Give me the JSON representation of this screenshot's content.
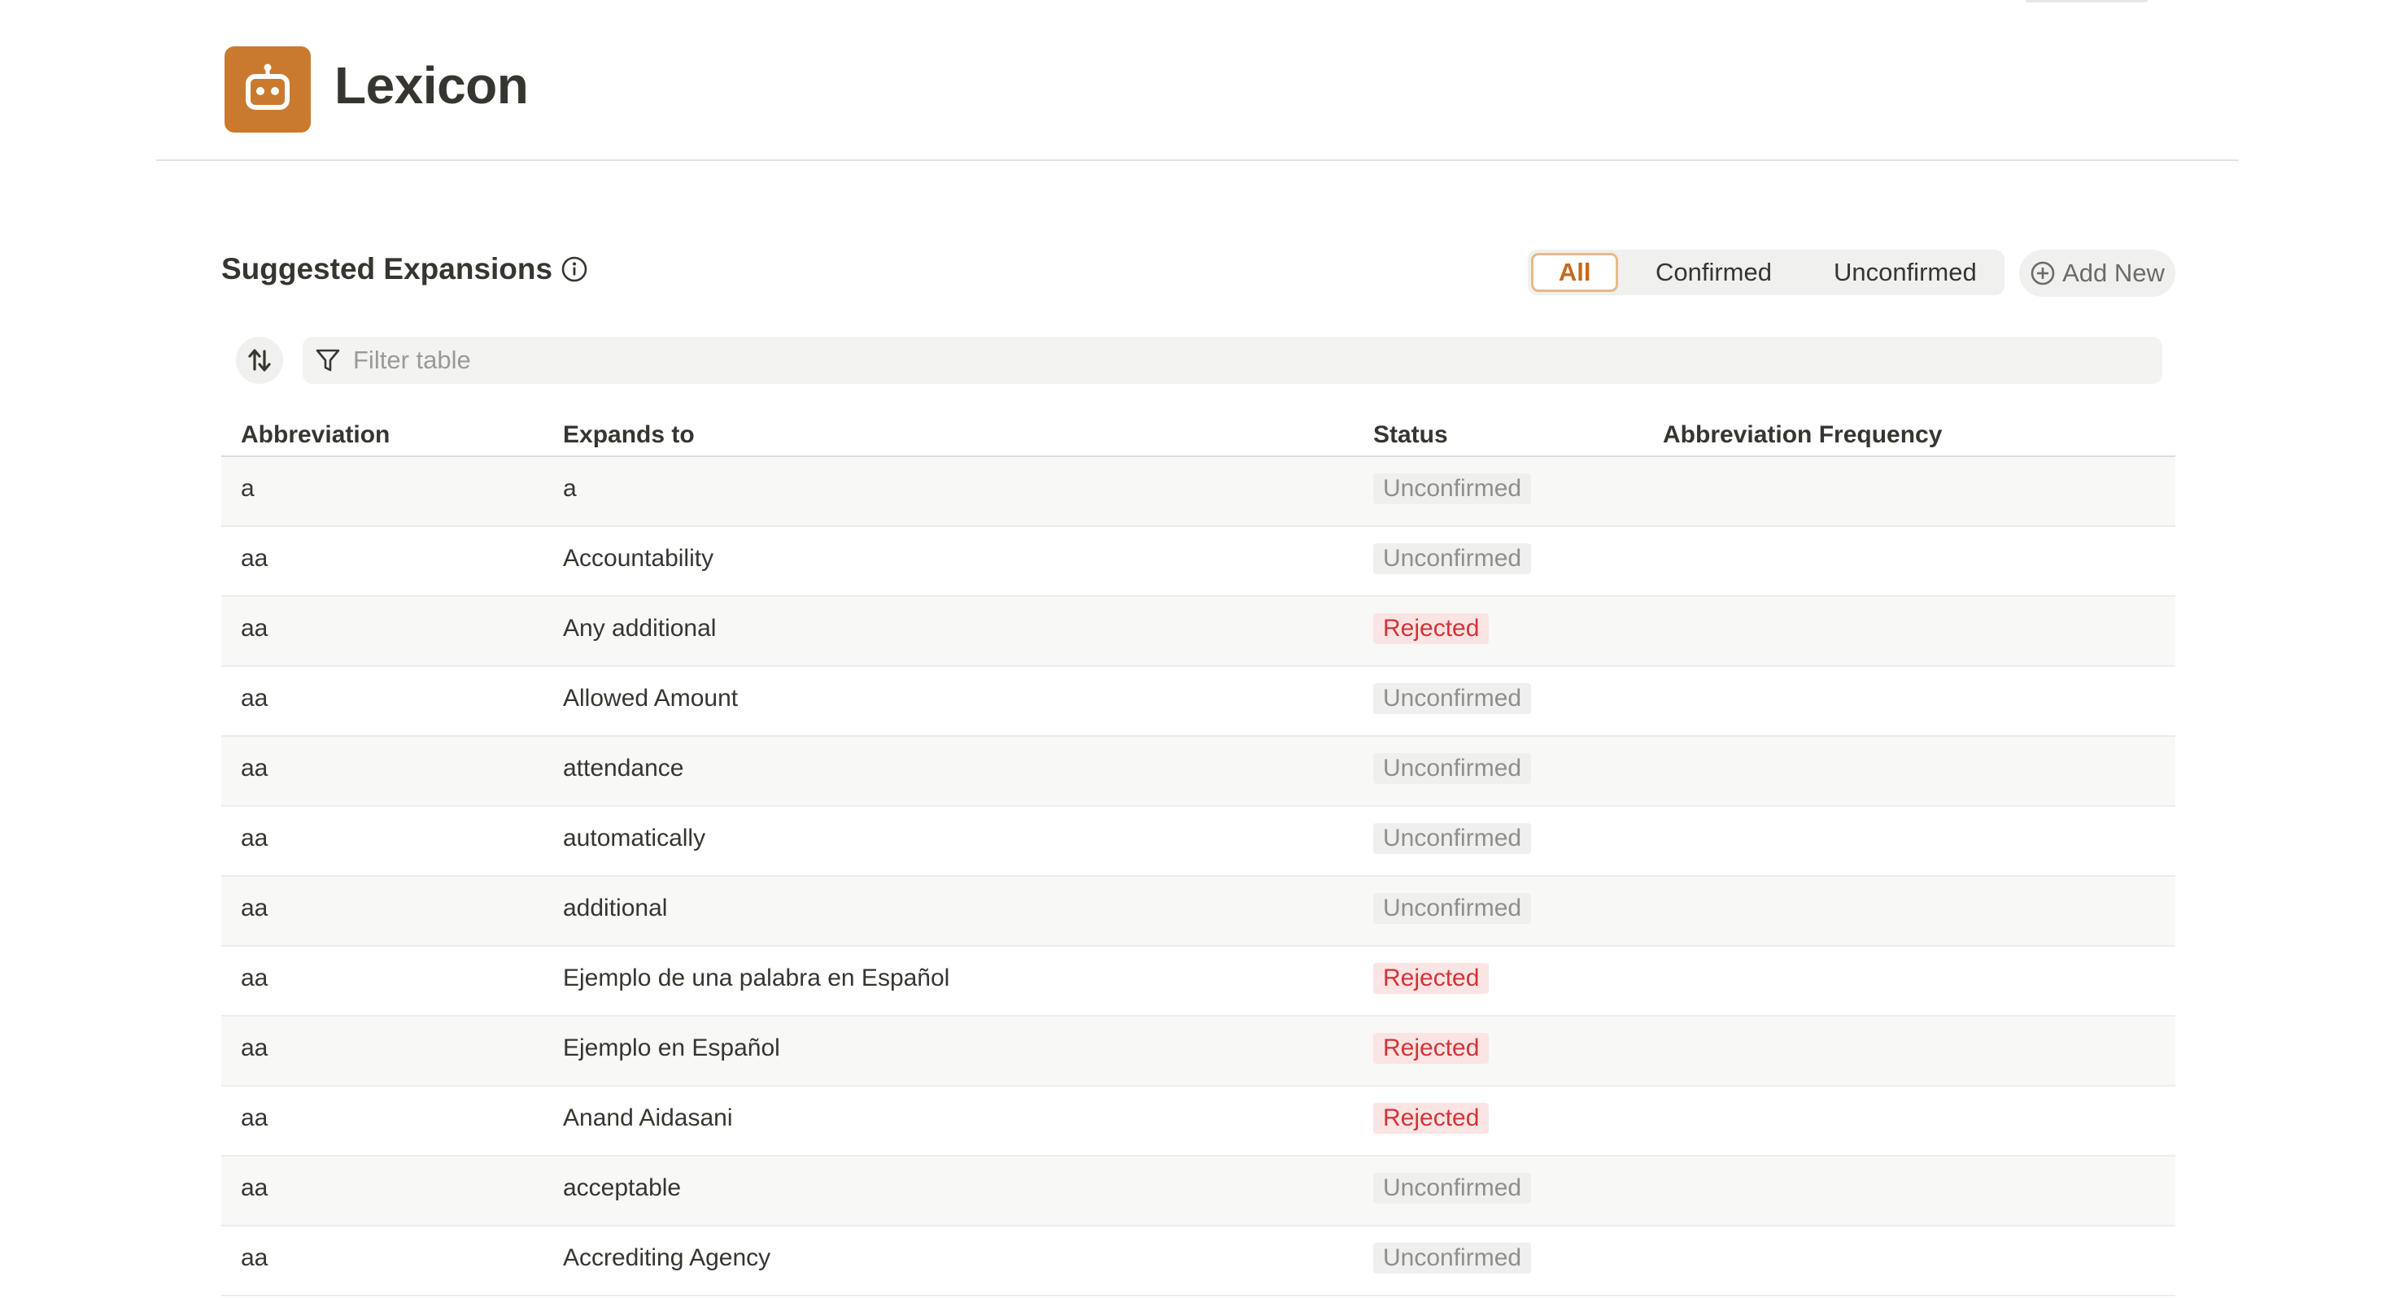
{
  "app": {
    "title": "Lexicon",
    "icon": "robot-icon",
    "accent": "#c97a2f"
  },
  "section": {
    "title": "Suggested Expansions",
    "info_icon": "info-icon"
  },
  "filters": {
    "tabs": [
      {
        "label": "All",
        "active": true
      },
      {
        "label": "Confirmed",
        "active": false
      },
      {
        "label": "Unconfirmed",
        "active": false
      }
    ],
    "add_new_label": "Add New"
  },
  "search": {
    "placeholder": "Filter table",
    "value": ""
  },
  "table": {
    "columns": [
      "Abbreviation",
      "Expands to",
      "Status",
      "Abbreviation Frequency"
    ],
    "rows": [
      {
        "abbr": "a",
        "expansion": "a",
        "status": "Unconfirmed",
        "frequency": ""
      },
      {
        "abbr": "aa",
        "expansion": "Accountability",
        "status": "Unconfirmed",
        "frequency": ""
      },
      {
        "abbr": "aa",
        "expansion": "Any additional",
        "status": "Rejected",
        "frequency": ""
      },
      {
        "abbr": "aa",
        "expansion": "Allowed Amount",
        "status": "Unconfirmed",
        "frequency": ""
      },
      {
        "abbr": "aa",
        "expansion": "attendance",
        "status": "Unconfirmed",
        "frequency": ""
      },
      {
        "abbr": "aa",
        "expansion": "automatically",
        "status": "Unconfirmed",
        "frequency": ""
      },
      {
        "abbr": "aa",
        "expansion": "additional",
        "status": "Unconfirmed",
        "frequency": ""
      },
      {
        "abbr": "aa",
        "expansion": "Ejemplo de una palabra en Español",
        "status": "Rejected",
        "frequency": ""
      },
      {
        "abbr": "aa",
        "expansion": "Ejemplo en Español",
        "status": "Rejected",
        "frequency": ""
      },
      {
        "abbr": "aa",
        "expansion": "Anand Aidasani",
        "status": "Rejected",
        "frequency": ""
      },
      {
        "abbr": "aa",
        "expansion": "acceptable",
        "status": "Unconfirmed",
        "frequency": ""
      },
      {
        "abbr": "aa",
        "expansion": "Accrediting Agency",
        "status": "Unconfirmed",
        "frequency": ""
      }
    ]
  },
  "colors": {
    "rejected": "#d13438",
    "unconfirmed": "#8f8e8a",
    "active_tab": "#c26a1e"
  }
}
